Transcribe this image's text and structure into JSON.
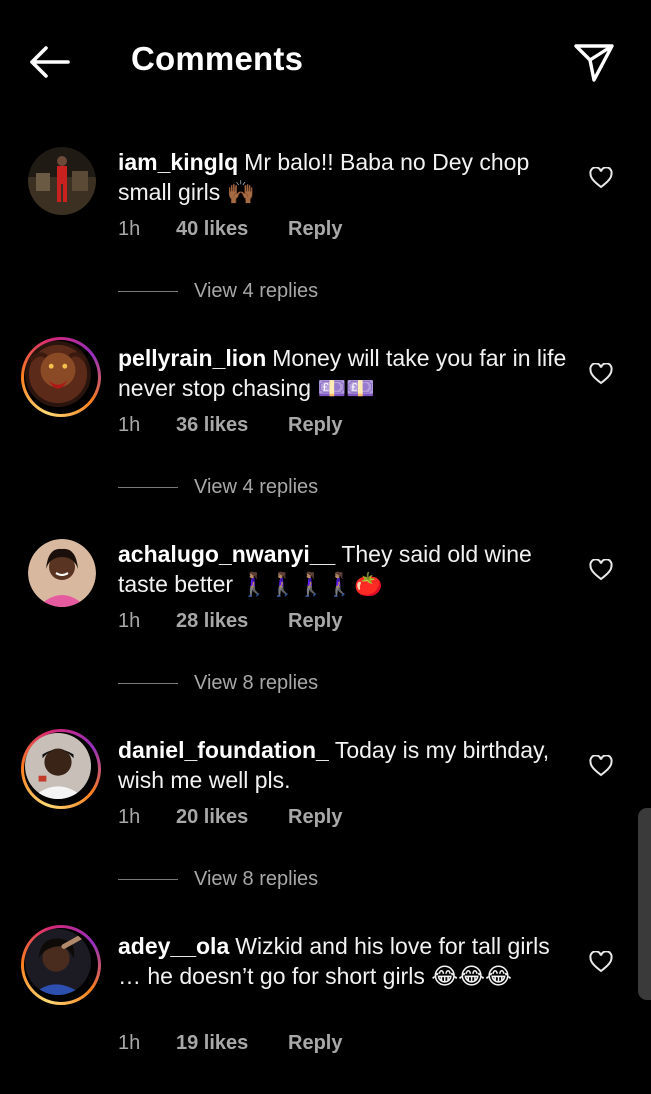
{
  "header": {
    "title": "Comments",
    "back_icon": "arrow-left-icon",
    "send_icon": "paper-plane-icon"
  },
  "comments": [
    {
      "username": "iam_kinglq",
      "text": "Mr  balo!! Baba no Dey chop small girls 🙌🏾",
      "time": "1h",
      "likes": "40 likes",
      "reply": "Reply",
      "view_replies": "View 4 replies"
    },
    {
      "username": "pellyrain_lion",
      "text": "Money will take you far in life never stop  chasing 💷💷",
      "time": "1h",
      "likes": "36 likes",
      "reply": "Reply",
      "view_replies": "View 4 replies"
    },
    {
      "username": "achalugo_nwanyi__",
      "text": "They said old wine taste better 🚶🏽‍♀️🚶🏽‍♀️🚶🏽‍♀️🚶🏽‍♀️🍅",
      "time": "1h",
      "likes": "28 likes",
      "reply": "Reply",
      "view_replies": "View 8 replies"
    },
    {
      "username": "daniel_foundation_",
      "text": "Today is my birthday, wish me well pls.",
      "time": "1h",
      "likes": "20 likes",
      "reply": "Reply",
      "view_replies": "View 8 replies"
    },
    {
      "username": "adey__ola",
      "text": "Wizkid and his love for tall girls … he doesn’t go for short girls 😂😂😂",
      "time": "1h",
      "likes": "19 likes",
      "reply": "Reply"
    }
  ],
  "colors": {
    "background": "#000000",
    "secondary_text": "#a8a8a8",
    "story_ring": "#d62976"
  }
}
